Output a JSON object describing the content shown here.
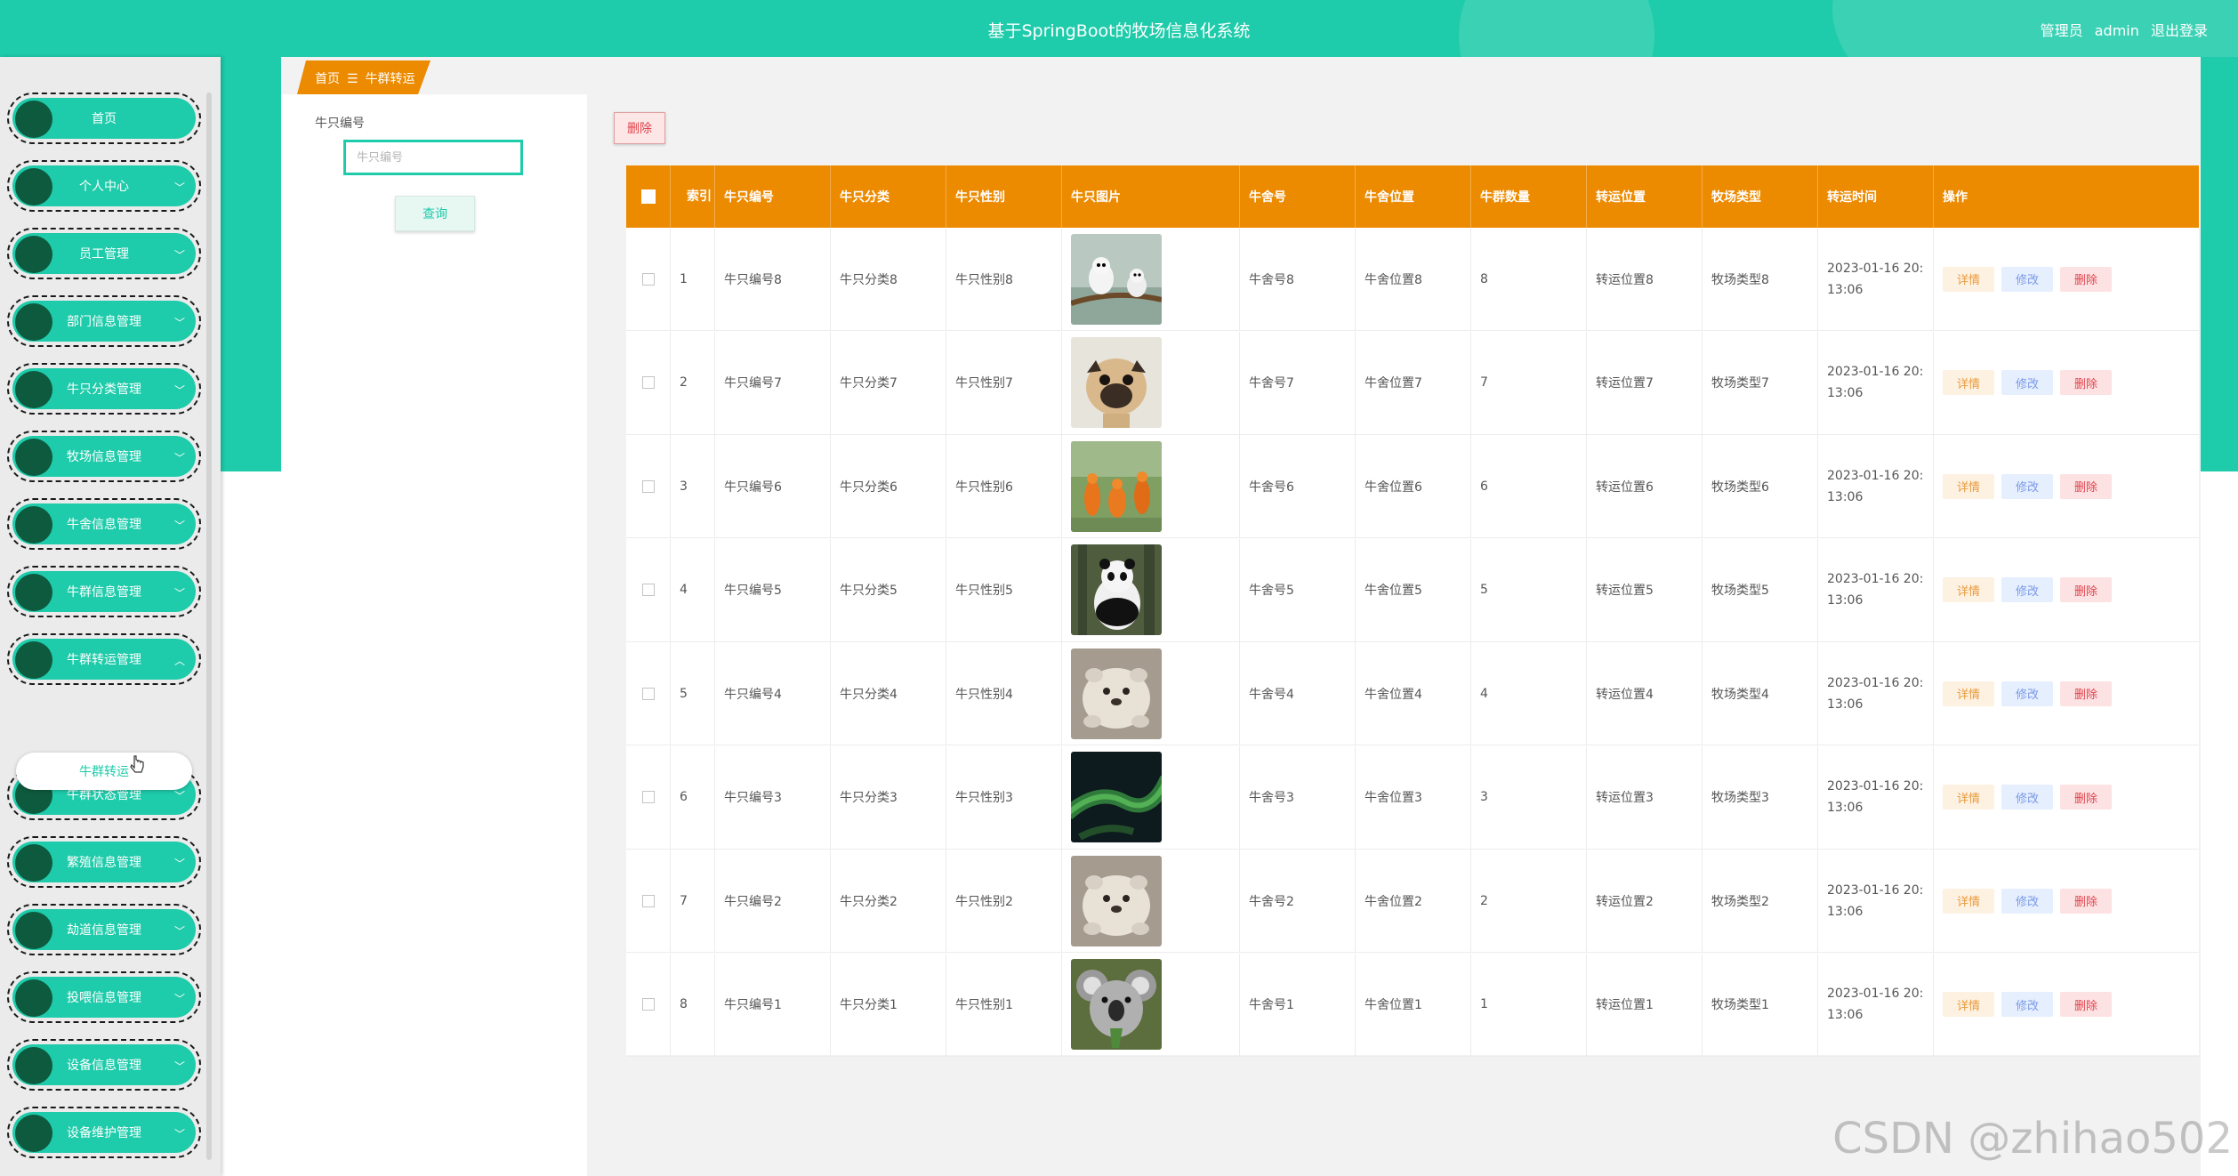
{
  "header": {
    "title": "基于SpringBoot的牧场信息化系统",
    "role": "管理员",
    "username": "admin",
    "logout": "退出登录"
  },
  "sidebar": {
    "items": [
      {
        "label": "首页",
        "expandable": false
      },
      {
        "label": "个人中心",
        "expandable": true
      },
      {
        "label": "员工管理",
        "expandable": true
      },
      {
        "label": "部门信息管理",
        "expandable": true
      },
      {
        "label": "牛只分类管理",
        "expandable": true
      },
      {
        "label": "牧场信息管理",
        "expandable": true
      },
      {
        "label": "牛舍信息管理",
        "expandable": true
      },
      {
        "label": "牛群信息管理",
        "expandable": true
      },
      {
        "label": "牛群转运管理",
        "expandable": true,
        "expanded": true
      },
      {
        "label": "牛群状态管理",
        "expandable": true
      },
      {
        "label": "繁殖信息管理",
        "expandable": true
      },
      {
        "label": "劫道信息管理",
        "expandable": true
      },
      {
        "label": "投喂信息管理",
        "expandable": true
      },
      {
        "label": "设备信息管理",
        "expandable": true
      },
      {
        "label": "设备维护管理",
        "expandable": true
      }
    ],
    "submenu": {
      "label": "牛群转运"
    }
  },
  "breadcrumb": {
    "home": "首页",
    "separator": "☰",
    "current": "牛群转运"
  },
  "search": {
    "label": "牛只编号",
    "placeholder": "牛只编号",
    "button": "查询"
  },
  "toolbar": {
    "delete_label": "删除"
  },
  "table": {
    "headers": [
      "索引",
      "牛只编号",
      "牛只分类",
      "牛只性别",
      "牛只图片",
      "牛舍号",
      "牛舍位置",
      "牛群数量",
      "转运位置",
      "牧场类型",
      "转运时间",
      "操作"
    ],
    "actions": {
      "detail": "详情",
      "edit": "修改",
      "delete": "删除"
    },
    "rows": [
      {
        "index": "1",
        "id": "牛只编号8",
        "category": "牛只分类8",
        "gender": "牛只性别8",
        "image": "two-white-birds",
        "barn": "牛舍号8",
        "location": "牛舍位置8",
        "count": "8",
        "transfer": "转运位置8",
        "ranch": "牧场类型8",
        "time": "2023-01-16 20:",
        "time2": "13:06"
      },
      {
        "index": "2",
        "id": "牛只编号7",
        "category": "牛只分类7",
        "gender": "牛只性别7",
        "image": "pug-dog",
        "barn": "牛舍号7",
        "location": "牛舍位置7",
        "count": "7",
        "transfer": "转运位置7",
        "ranch": "牧场类型7",
        "time": "2023-01-16 20:",
        "time2": "13:06"
      },
      {
        "index": "3",
        "id": "牛只编号6",
        "category": "牛只分类6",
        "gender": "牛只性别6",
        "image": "orange-kangaroos",
        "barn": "牛舍号6",
        "location": "牛舍位置6",
        "count": "6",
        "transfer": "转运位置6",
        "ranch": "牧场类型6",
        "time": "2023-01-16 20:",
        "time2": "13:06"
      },
      {
        "index": "4",
        "id": "牛只编号5",
        "category": "牛只分类5",
        "gender": "牛只性别5",
        "image": "panda",
        "barn": "牛舍号5",
        "location": "牛舍位置5",
        "count": "5",
        "transfer": "转运位置5",
        "ranch": "牧场类型5",
        "time": "2023-01-16 20:",
        "time2": "13:06"
      },
      {
        "index": "5",
        "id": "牛只编号4",
        "category": "牛只分类4",
        "gender": "牛只性别4",
        "image": "fluffy-puppy",
        "barn": "牛舍号4",
        "location": "牛舍位置4",
        "count": "4",
        "transfer": "转运位置4",
        "ranch": "牧场类型4",
        "time": "2023-01-16 20:",
        "time2": "13:06"
      },
      {
        "index": "6",
        "id": "牛只编号3",
        "category": "牛只分类3",
        "gender": "牛只性别3",
        "image": "green-snake",
        "barn": "牛舍号3",
        "location": "牛舍位置3",
        "count": "3",
        "transfer": "转运位置3",
        "ranch": "牧场类型3",
        "time": "2023-01-16 20:",
        "time2": "13:06"
      },
      {
        "index": "7",
        "id": "牛只编号2",
        "category": "牛只分类2",
        "gender": "牛只性别2",
        "image": "fluffy-puppy",
        "barn": "牛舍号2",
        "location": "牛舍位置2",
        "count": "2",
        "transfer": "转运位置2",
        "ranch": "牧场类型2",
        "time": "2023-01-16 20:",
        "time2": "13:06"
      },
      {
        "index": "8",
        "id": "牛只编号1",
        "category": "牛只分类1",
        "gender": "牛只性别1",
        "image": "koala",
        "barn": "牛舍号1",
        "location": "牛舍位置1",
        "count": "1",
        "transfer": "转运位置1",
        "ranch": "牧场类型1",
        "time": "2023-01-16 20:",
        "time2": "13:06"
      }
    ]
  },
  "watermark": "CSDN @zhihao502",
  "colors": {
    "primary": "#1ecbaa",
    "header_orange": "#ec8a00",
    "danger": "#e0444d",
    "menu_ball": "#0e5a3e"
  }
}
